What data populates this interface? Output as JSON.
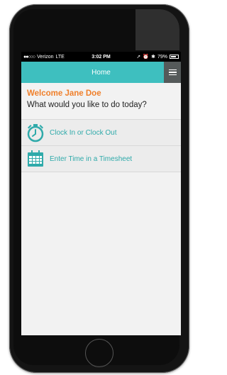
{
  "status_bar": {
    "carrier": "Verizon",
    "network": "LTE",
    "time": "3:02 PM",
    "battery_percent": "79%",
    "battery_level": 0.79
  },
  "header": {
    "title": "Home",
    "menu_icon": "hamburger-menu-icon"
  },
  "welcome": {
    "greeting": "Welcome Jane Doe",
    "prompt": "What would you like to do today?"
  },
  "actions": [
    {
      "label": "Clock In or Clock Out",
      "icon": "stopwatch-icon"
    },
    {
      "label": "Enter Time in a Timesheet",
      "icon": "calendar-icon"
    }
  ],
  "colors": {
    "header": "#3ebfbf",
    "greeting": "#f07f2a",
    "action_text": "#2faaaa",
    "menu_button": "#555a5a"
  }
}
